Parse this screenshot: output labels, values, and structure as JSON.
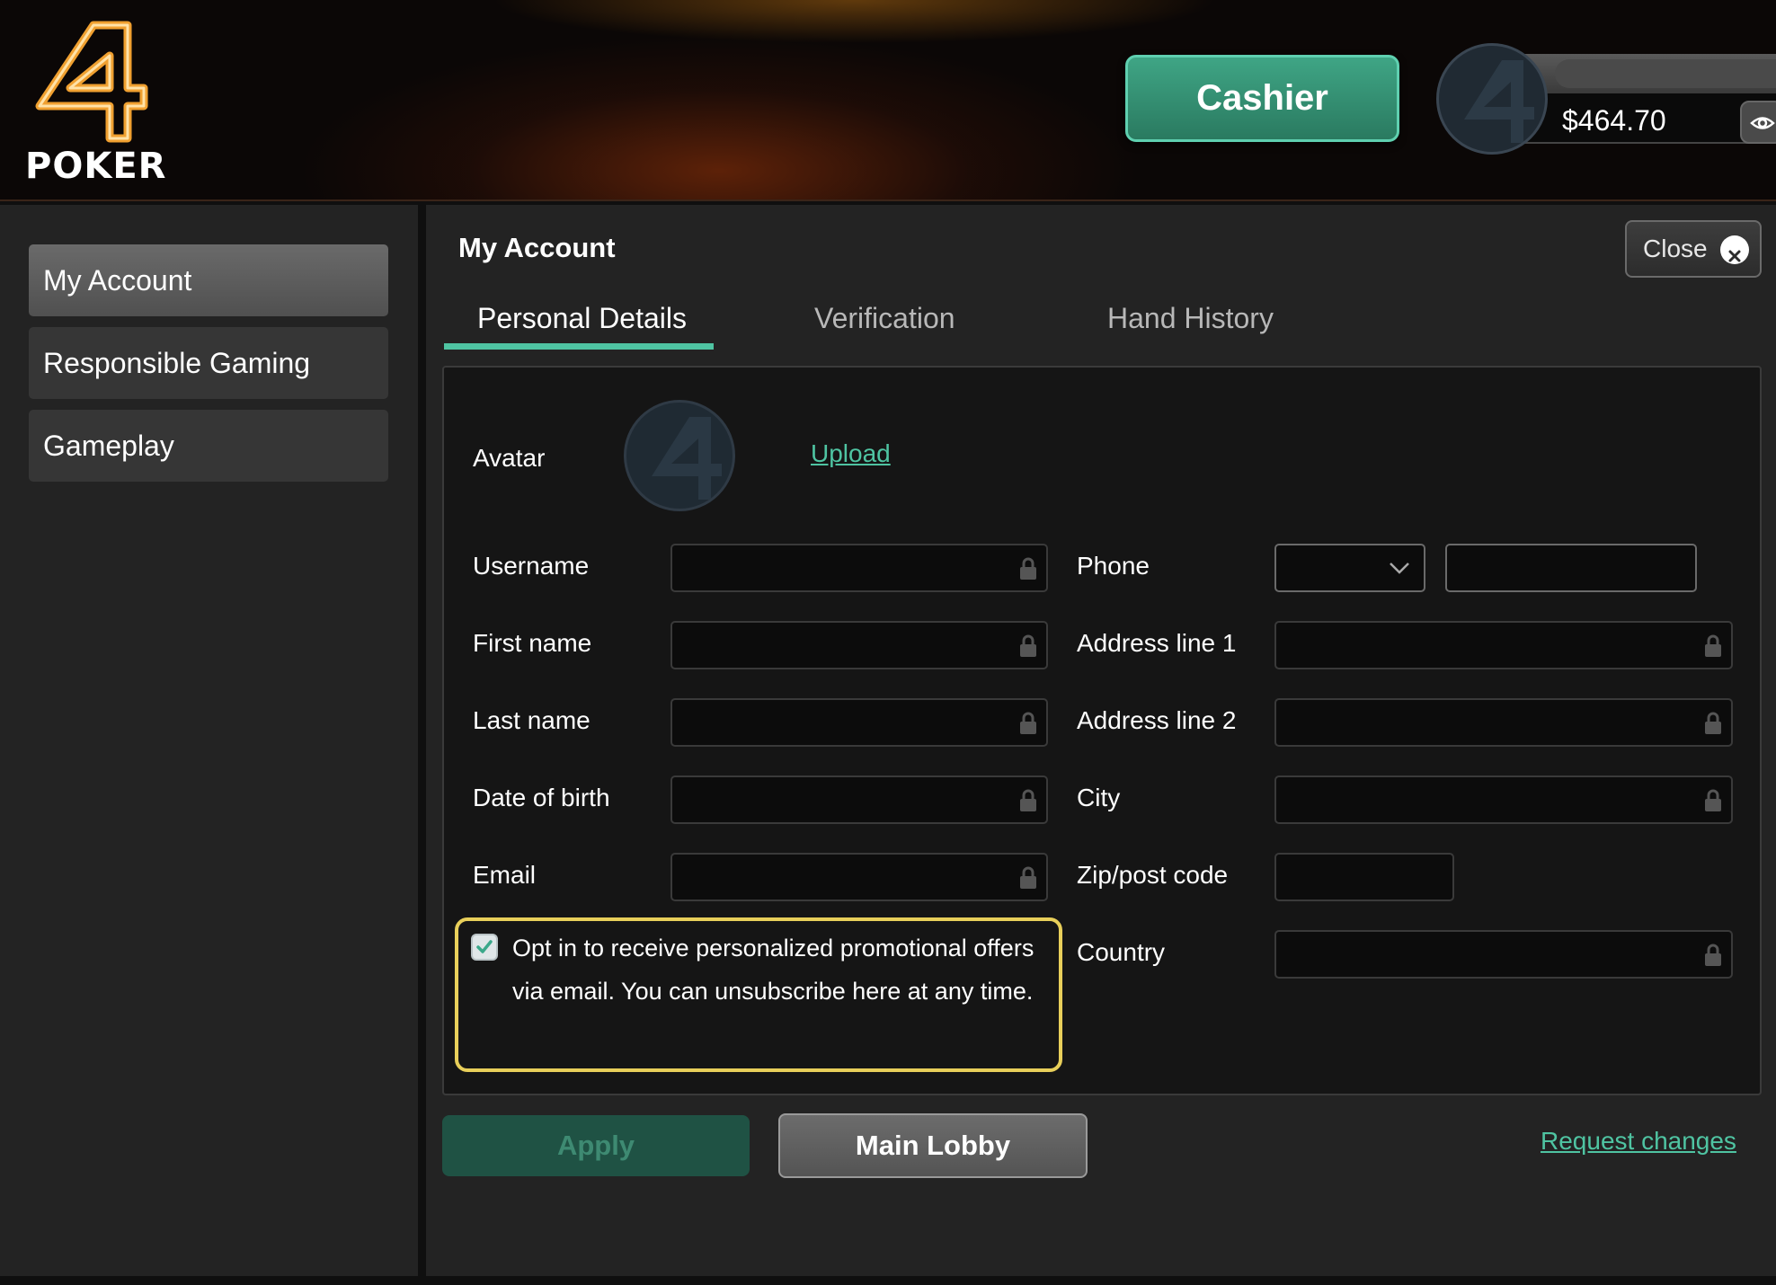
{
  "header": {
    "logo_text": "POKER",
    "cashier_label": "Cashier",
    "balance": "$464.70"
  },
  "sidebar": {
    "items": [
      {
        "label": "My Account",
        "active": true
      },
      {
        "label": "Responsible Gaming",
        "active": false
      },
      {
        "label": "Gameplay",
        "active": false
      }
    ]
  },
  "main": {
    "title": "My Account",
    "close_label": "Close",
    "tabs": [
      {
        "label": "Personal Details",
        "active": true
      },
      {
        "label": "Verification",
        "active": false
      },
      {
        "label": "Hand History",
        "active": false
      }
    ],
    "form": {
      "avatar_label": "Avatar",
      "upload_label": "Upload",
      "left_fields": [
        {
          "label": "Username",
          "value": ""
        },
        {
          "label": "First name",
          "value": ""
        },
        {
          "label": "Last name",
          "value": ""
        },
        {
          "label": "Date of birth",
          "value": ""
        },
        {
          "label": "Email",
          "value": ""
        }
      ],
      "right_fields": [
        {
          "label": "Phone",
          "value": ""
        },
        {
          "label": "Address line 1",
          "value": ""
        },
        {
          "label": "Address line 2",
          "value": ""
        },
        {
          "label": "City",
          "value": ""
        },
        {
          "label": "Zip/post code",
          "value": ""
        },
        {
          "label": "Country",
          "value": ""
        }
      ],
      "opt_in_checked": true,
      "opt_in_text": "Opt in to receive personalized promotional offers via email. You can unsubscribe here at any time."
    },
    "apply_label": "Apply",
    "main_lobby_label": "Main Lobby",
    "request_changes_label": "Request changes"
  },
  "colors": {
    "accent": "#4fc4a2",
    "cashier": "#3fa585",
    "highlight": "#e8cf5a",
    "logo": "#f0a030"
  }
}
